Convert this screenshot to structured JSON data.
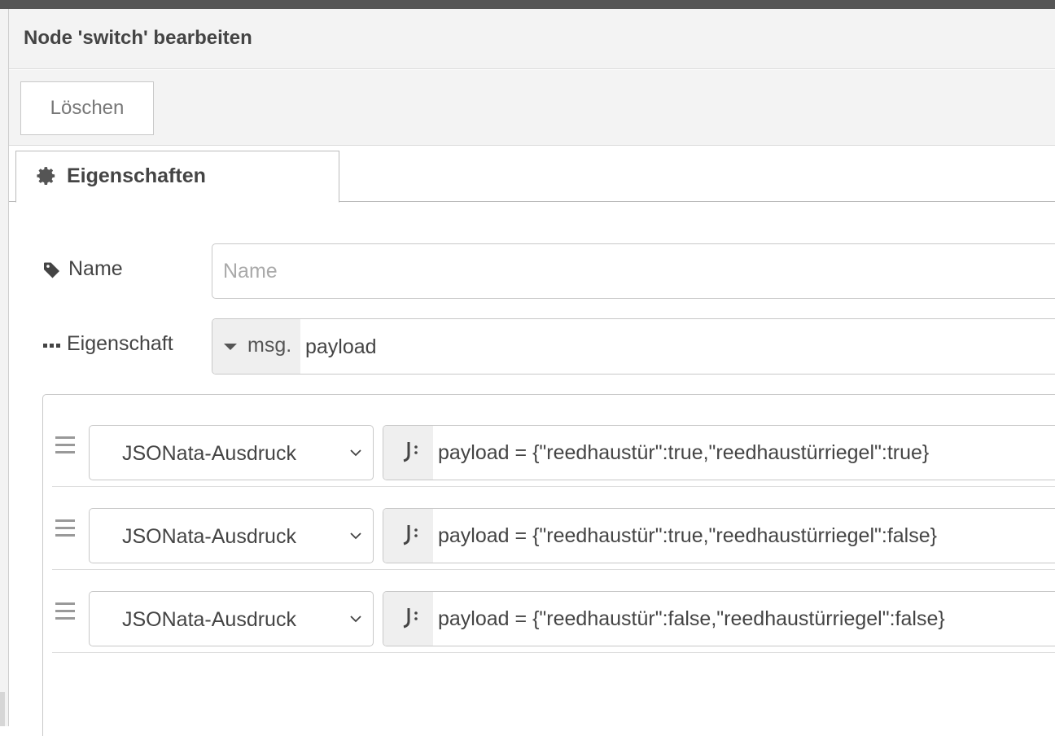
{
  "tray": {
    "title": "Node 'switch' bearbeiten",
    "delete_label": "Löschen"
  },
  "tabs": [
    {
      "label": "Eigenschaften",
      "icon": "gear-icon",
      "active": true
    }
  ],
  "form": {
    "name": {
      "label": "Name",
      "icon": "tag-icon",
      "value": "",
      "placeholder": "Name"
    },
    "property": {
      "label": "Eigenschaft",
      "icon": "ellipsis-icon",
      "type_prefix": "msg.",
      "value": "payload"
    }
  },
  "rules": [
    {
      "operator": "JSONata-Ausdruck",
      "value_type": "jsonata-icon",
      "value": "payload = {\"reedhaustür\":true,\"reedhaustürriegel\":true}"
    },
    {
      "operator": "JSONata-Ausdruck",
      "value_type": "jsonata-icon",
      "value": "payload = {\"reedhaustür\":true,\"reedhaustürriegel\":false}"
    },
    {
      "operator": "JSONata-Ausdruck",
      "value_type": "jsonata-icon",
      "value": "payload = {\"reedhaustür\":false,\"reedhaustürriegel\":false}"
    }
  ],
  "colors": {
    "topbar": "#555555",
    "panel_bg": "#f3f3f3",
    "border": "#c8c8c8",
    "text": "#444444",
    "placeholder": "#aaaaaa"
  }
}
